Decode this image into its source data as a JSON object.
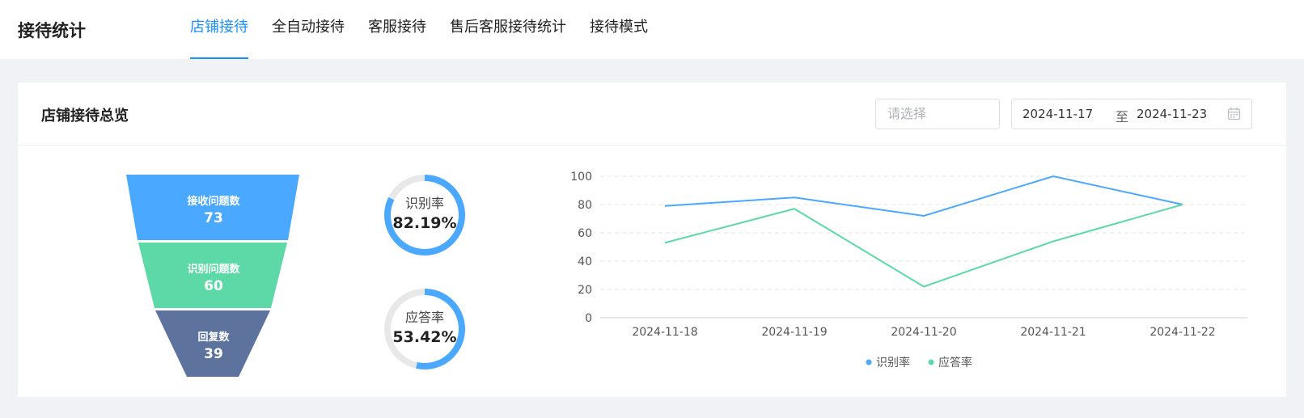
{
  "app": {
    "title": "接待统计"
  },
  "tabs": [
    {
      "label": "店铺接待",
      "active": true
    },
    {
      "label": "全自动接待",
      "active": false
    },
    {
      "label": "客服接待",
      "active": false
    },
    {
      "label": "售后客服接待统计",
      "active": false
    },
    {
      "label": "接待模式",
      "active": false
    }
  ],
  "overview": {
    "title": "店铺接待总览",
    "select_placeholder": "请选择",
    "date_start": "2024-11-17",
    "date_separator": "至",
    "date_end": "2024-11-23",
    "calendar_icon": "calendar-icon"
  },
  "funnel": [
    {
      "label": "接收问题数",
      "value": "73",
      "color": "#4aa8ff"
    },
    {
      "label": "识别问题数",
      "value": "60",
      "color": "#5cd9a6"
    },
    {
      "label": "回复数",
      "value": "39",
      "color": "#5d729c"
    }
  ],
  "gauges": [
    {
      "label": "识别率",
      "value": "82.19%",
      "percent": 82.19,
      "color": "#4aa8ff"
    },
    {
      "label": "应答率",
      "value": "53.42%",
      "percent": 53.42,
      "color": "#4aa8ff"
    }
  ],
  "chart_data": {
    "type": "line",
    "x": [
      "2024-11-18",
      "2024-11-19",
      "2024-11-20",
      "2024-11-21",
      "2024-11-22"
    ],
    "series": [
      {
        "name": "识别率",
        "values": [
          79,
          85,
          72,
          100,
          80
        ],
        "color": "#4aa8ff"
      },
      {
        "name": "应答率",
        "values": [
          53,
          77,
          22,
          54,
          80
        ],
        "color": "#5cd9a6"
      }
    ],
    "yticks": [
      "0",
      "20",
      "40",
      "60",
      "80",
      "100"
    ],
    "ylim": [
      0,
      100
    ],
    "grid": true,
    "legend": "bottom-center"
  }
}
